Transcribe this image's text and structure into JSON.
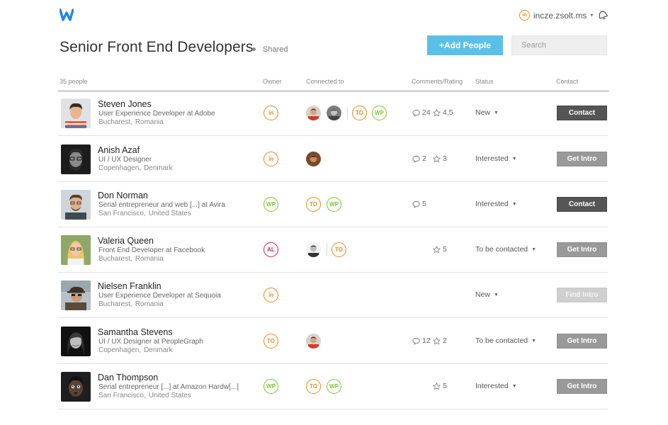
{
  "header": {
    "user_badge": "in",
    "username": "incze.zsolt.ms",
    "username_caret": "▾",
    "brand_color": "#1e88e5"
  },
  "page": {
    "title": "Senior Front End Developers",
    "shared_label": "Shared",
    "add_button": "+Add People",
    "search_placeholder": "Search"
  },
  "table": {
    "headers": {
      "count": "35 people",
      "owner": "Owner",
      "connected": "Connected to",
      "comments": "Comments/Rating",
      "status": "Status",
      "contact": "Contact"
    },
    "rows": [
      {
        "name": "Steven Jones",
        "role": "User Experience Developer at Adobe",
        "city": "Bucharest,",
        "country": "Romania",
        "owner": "in",
        "comments": "24",
        "rating": "4,5",
        "status": "New",
        "action": "Contact",
        "badge_to": "TO",
        "badge_wp": "WP"
      },
      {
        "name": "Anish Azaf",
        "role": "UI / UX Designer",
        "city": "Copenhagen,",
        "country": "Denmark",
        "owner": "in",
        "comments": "2",
        "rating": "3",
        "status": "Interested",
        "action": "Get Intro"
      },
      {
        "name": "Don Norman",
        "role": "Serial entrepreneur and web [...] at Avira",
        "city": "San Francisco,",
        "country": "United States",
        "owner": "WP",
        "comments": "5",
        "status": "Interested",
        "action": "Contact",
        "badge_to": "TO",
        "badge_wp": "WP"
      },
      {
        "name": "Valeria Queen",
        "role": "Front End Developer at Facebook",
        "city": "Bucharest,",
        "country": "Romania",
        "owner": "AL",
        "rating": "5",
        "status": "To be contacted",
        "action": "Get Intro",
        "badge_to": "TO"
      },
      {
        "name": "Nielsen Franklin",
        "role": "User Experience Developer at Sequoia",
        "city": "Bucharest,",
        "country": "Romania",
        "owner": "in",
        "status": "New",
        "action": "Find Intro"
      },
      {
        "name": "Samantha Stevens",
        "role": "UI / UX Designer at PeopleGraph",
        "city": "Copenhagen,",
        "country": "Denmark",
        "owner": "TO",
        "comments": "12",
        "rating": "2",
        "status": "To be contacted",
        "action": "Get Intro"
      },
      {
        "name": "Dan Thompson",
        "role": "Serial entrepreneur [...] at Amazon Hardw[...]",
        "city": "San Francisco,",
        "country": "United States",
        "owner": "WP",
        "rating": "5",
        "status": "Interested",
        "action": "Get Intro",
        "badge_to": "TO",
        "badge_wp": "WP"
      }
    ]
  },
  "icons": {
    "logo": "w-logo-icon",
    "notifications": "bell-icon",
    "comment": "speech-bubble-icon",
    "rating": "star-outline-icon",
    "dropdown": "caret-down-icon"
  }
}
